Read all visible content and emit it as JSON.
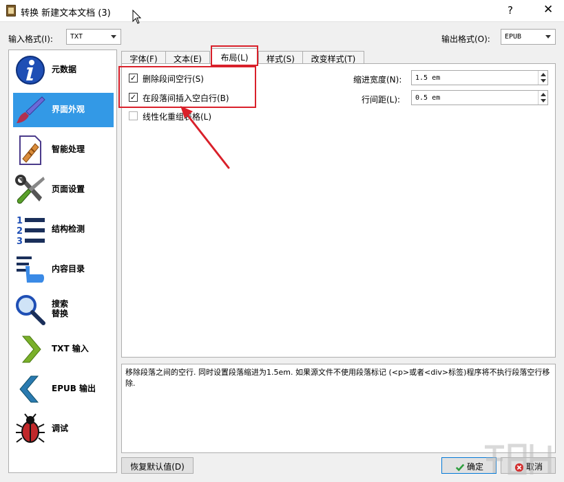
{
  "window": {
    "title": "转换 新建文本文档 (3)",
    "help": "?",
    "close": "✕"
  },
  "input_format": {
    "label": "输入格式(I):",
    "value": "TXT"
  },
  "output_format": {
    "label": "输出格式(O):",
    "value": "EPUB"
  },
  "sidebar": {
    "items": [
      {
        "label": "元数据",
        "icon": "info-icon"
      },
      {
        "label": "界面外观",
        "icon": "paintbrush-icon"
      },
      {
        "label": "智能处理",
        "icon": "document-wand-icon"
      },
      {
        "label": "页面设置",
        "icon": "wrench-screwdriver-icon"
      },
      {
        "label": "结构检测",
        "icon": "numbered-list-icon"
      },
      {
        "label": "内容目录",
        "icon": "toc-hand-icon"
      },
      {
        "label": "搜索\n替换",
        "icon": "magnifier-icon"
      },
      {
        "label": "TXT 输入",
        "icon": "chevron-right-icon"
      },
      {
        "label": "EPUB 输出",
        "icon": "chevron-left-icon"
      },
      {
        "label": "调试",
        "icon": "bug-icon"
      }
    ],
    "selected": "界面外观"
  },
  "tabs": [
    {
      "label": "字体(F)"
    },
    {
      "label": "文本(E)"
    },
    {
      "label": "布局(L)"
    },
    {
      "label": "样式(S)"
    },
    {
      "label": "改变样式(T)"
    }
  ],
  "active_tab": "布局(L)",
  "layout": {
    "remove_spacing": {
      "label": "删除段间空行(S)",
      "checked": true,
      "mark": "✓"
    },
    "insert_blank": {
      "label": "在段落间插入空白行(B)",
      "checked": true,
      "mark": "✓"
    },
    "linearize": {
      "label": "线性化重组表格(L)",
      "checked": false
    },
    "indent": {
      "label": "缩进宽度(N):",
      "value": "1.5 em"
    },
    "line_spacing": {
      "label": "行间距(L):",
      "value": "0.5 em"
    }
  },
  "description": "移除段落之间的空行. 同时设置段落缩进为1.5em. 如果源文件不使用段落标记 (<p>或者<div>标签)程序将不执行段落空行移除.",
  "buttons": {
    "restore": "恢复默认值(D)",
    "ok": "确定",
    "cancel": "取消"
  },
  "colors": {
    "selected_bg": "#3399e6",
    "highlight": "#d9202a",
    "ok_icon": "#2e9e3e",
    "cancel_icon": "#d32f2f"
  }
}
